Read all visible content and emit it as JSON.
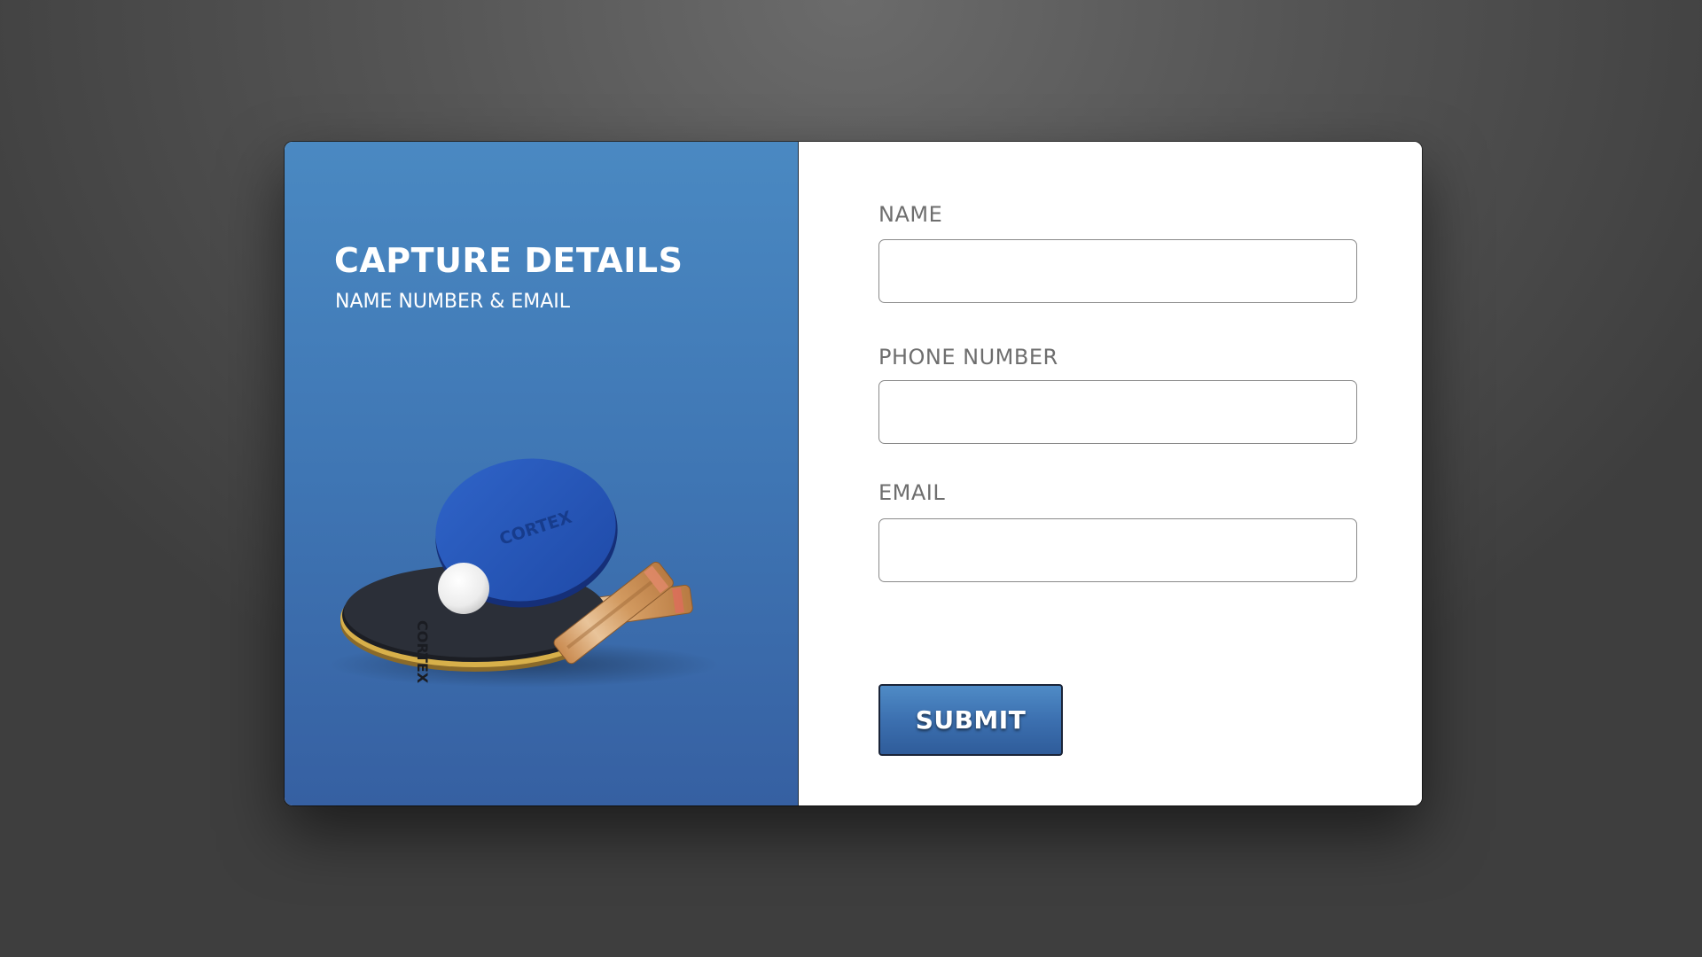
{
  "left_panel": {
    "title": "CAPTURE DETAILS",
    "subtitle": "NAME NUMBER & EMAIL",
    "image": {
      "icon": "table-tennis-paddles-image",
      "brand_text": "CORTEX"
    }
  },
  "form": {
    "fields": [
      {
        "label": "NAME",
        "value": "",
        "placeholder": ""
      },
      {
        "label": "PHONE NUMBER",
        "value": "",
        "placeholder": ""
      },
      {
        "label": "EMAIL",
        "value": "",
        "placeholder": ""
      }
    ],
    "submit_label": "SUBMIT"
  },
  "colors": {
    "panel_blue": "#4283c0",
    "button_blue": "#3c70b0",
    "label_gray": "#6e6e6e"
  }
}
